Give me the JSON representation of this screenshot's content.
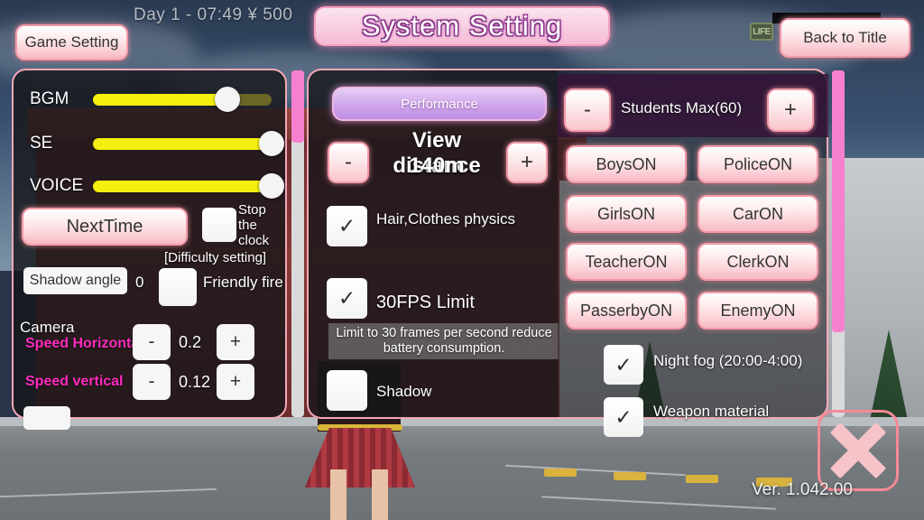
{
  "hud": {
    "status": "Day 1 - 07:49 ¥ 500",
    "life_badge": "LIFE"
  },
  "header": {
    "title": "System Setting",
    "game_setting_label": "Game Setting",
    "back_to_title_label": "Back to Title"
  },
  "left_panel": {
    "sliders": [
      {
        "label": "BGM",
        "value": 75
      },
      {
        "label": "SE",
        "value": 100
      },
      {
        "label": "VOICE",
        "value": 100
      }
    ],
    "next_time_label": "NextTime",
    "stop_clock_label": "Stop the clock",
    "difficulty_label": "[Difficulty setting]",
    "shadow_angle_label": "Shadow angle",
    "shadow_angle_value": "0",
    "friendly_fire_label": "Friendly fire",
    "camera_label": "Camera",
    "speed_horizontal_label": "Speed Horizontal",
    "speed_horizontal_value": "0.2",
    "speed_vertical_label": "Speed vertical",
    "speed_vertical_value": "0.12",
    "minus_label": "-",
    "plus_label": "+"
  },
  "center_panel": {
    "tab_label": "Performance",
    "view_distance_label": "View distance",
    "view_distance_value": "140m",
    "minus_label": "-",
    "plus_label": "+",
    "checkboxes": [
      {
        "label": "Hair,Clothes physics",
        "checked": true
      },
      {
        "label": "30FPS Limit",
        "checked": true
      },
      {
        "label": "Shadow",
        "checked": false
      }
    ],
    "tooltip": "Limit to 30 frames per second reduce battery consumption."
  },
  "right_panel": {
    "students_max_label": "Students Max(60)",
    "minus_label": "-",
    "plus_label": "+",
    "toggles": [
      "BoysON",
      "PoliceON",
      "GirlsON",
      "CarON",
      "TeacherON",
      "ClerkON",
      "PasserbyON",
      "EnemyON"
    ],
    "checkboxes": [
      {
        "label": "Night fog (20:00-4:00)",
        "checked": true
      },
      {
        "label": "Weapon material",
        "checked": true
      }
    ]
  },
  "footer": {
    "version": "Ver. 1.042.00",
    "close_icon": "close-x-icon"
  },
  "colors": {
    "pink_accent": "#f8b9c2",
    "pink_border": "#f49aa8",
    "scrollbar_thumb": "#f77fd0",
    "slider_fill": "#f5ef10",
    "magenta_label": "#ff2bbe",
    "purple_tab": "#c08ee6"
  }
}
